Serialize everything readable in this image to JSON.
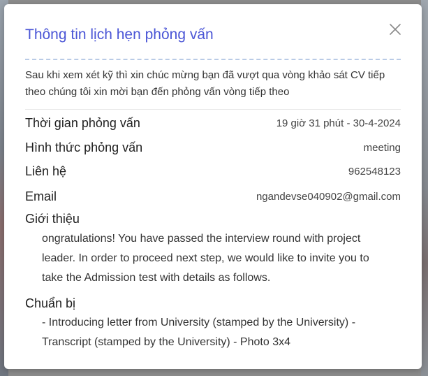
{
  "modal": {
    "title": "Thông tin lịch hẹn phỏng vấn",
    "close_icon": "close-icon",
    "intro": "Sau khi xem xét kỹ thì xin chúc mừng bạn đã vượt qua vòng khảo sát CV tiếp theo chúng tôi xin mời bạn đến phỏng vấn vòng tiếp theo",
    "rows": [
      {
        "label": "Thời gian phỏng vấn",
        "value": "19 giờ 31 phút - 30-4-2024"
      },
      {
        "label": "Hình thức phỏng vấn",
        "value": "meeting"
      },
      {
        "label": "Liên hệ",
        "value": "962548123"
      },
      {
        "label": "Email",
        "value": "ngandevse040902@gmail.com"
      }
    ],
    "intro_section": {
      "title": "Giới thiệu",
      "body": "ongratulations! You have passed the interview round with project leader. In order to proceed next step, we would like to invite you to take the Admission test with details as follows."
    },
    "prepare_section": {
      "title": "Chuẩn bị",
      "body": "- Introducing letter from University (stamped by the University) - Transcript (stamped by the University) - Photo 3x4"
    }
  },
  "colors": {
    "title": "#4b56d6",
    "divider": "#b9cbe6",
    "backdrop": "#8c8c8c"
  }
}
